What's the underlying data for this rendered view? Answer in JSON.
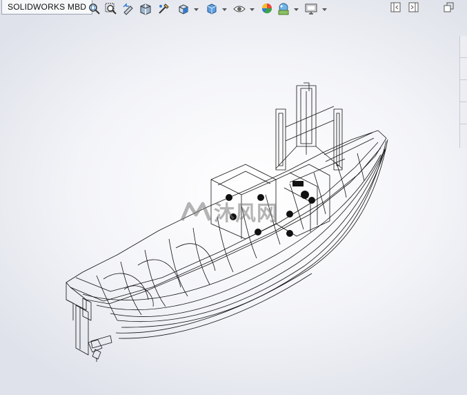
{
  "app": {
    "tab_label": "SOLIDWORKS MBD"
  },
  "toolbar": {
    "buttons": [
      {
        "name": "zoom-to-fit",
        "icon": "zoom-fit-icon"
      },
      {
        "name": "zoom-to-area",
        "icon": "zoom-area-icon"
      },
      {
        "name": "previous-view",
        "icon": "previous-view-icon"
      },
      {
        "name": "section-view",
        "icon": "section-view-icon"
      },
      {
        "name": "dynamic-annotation",
        "icon": "dynamic-annotation-icon"
      },
      {
        "name": "view-orientation",
        "icon": "view-orientation-icon"
      },
      {
        "name": "display-style",
        "icon": "display-style-icon"
      },
      {
        "name": "hide-show-items",
        "icon": "eye-icon"
      },
      {
        "name": "edit-appearance",
        "icon": "appearance-icon"
      },
      {
        "name": "apply-scene",
        "icon": "scene-icon"
      },
      {
        "name": "view-settings",
        "icon": "monitor-icon"
      }
    ],
    "window_controls": [
      "panel-left-icon",
      "panel-right-icon",
      "restore-window-icon"
    ]
  },
  "viewport": {
    "model": "boat-wireframe",
    "watermark_text": "沐风网"
  },
  "colors": {
    "wire": "#111111",
    "background": "#eef0f5",
    "accent_blue": "#2f7bd1"
  }
}
